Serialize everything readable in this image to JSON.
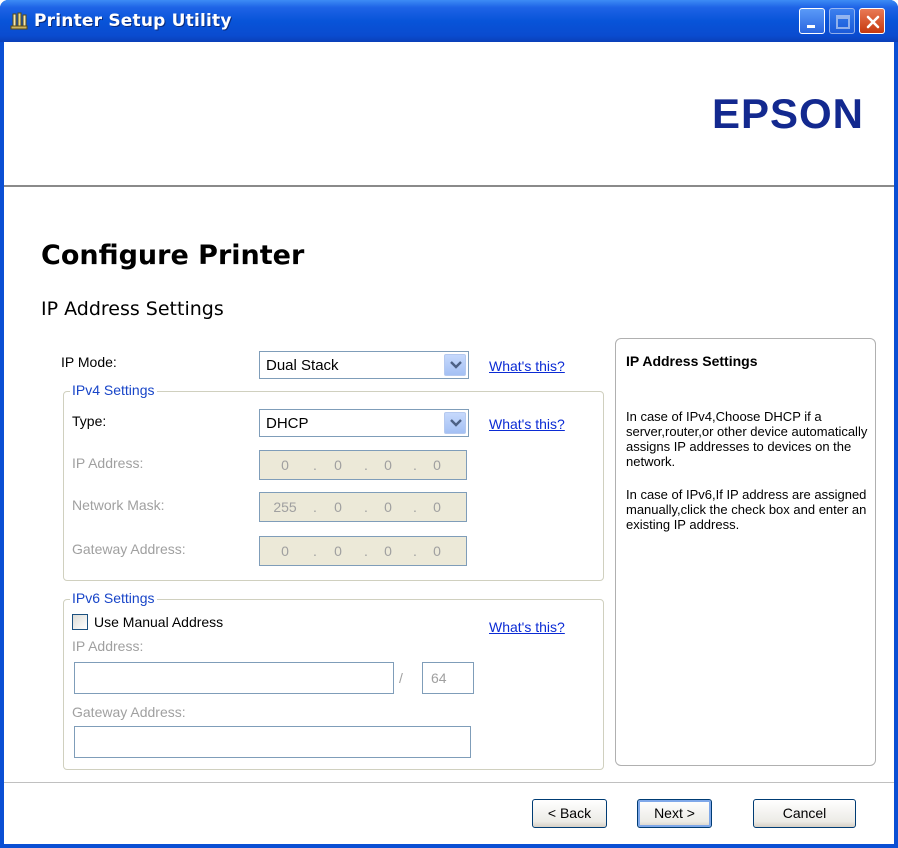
{
  "window": {
    "title": "Printer Setup Utility"
  },
  "header": {
    "logo": "EPSON"
  },
  "page": {
    "title": "Configure Printer",
    "subtitle": "IP Address Settings"
  },
  "ip_mode": {
    "label": "IP Mode:",
    "value": "Dual Stack",
    "help_link": "What's this?"
  },
  "ipv4": {
    "group_title": "IPv4 Settings",
    "type_label": "Type:",
    "type_value": "DHCP",
    "help_link": "What's this?",
    "ip_address_label": "IP Address:",
    "ip_address": [
      "0",
      "0",
      "0",
      "0"
    ],
    "network_mask_label": "Network Mask:",
    "network_mask": [
      "255",
      "0",
      "0",
      "0"
    ],
    "gateway_label": "Gateway Address:",
    "gateway": [
      "0",
      "0",
      "0",
      "0"
    ],
    "separator": "."
  },
  "ipv6": {
    "group_title": "IPv6 Settings",
    "manual_label": "Use Manual Address",
    "manual_checked": false,
    "help_link": "What's this?",
    "ip_address_label": "IP Address:",
    "ip_address_value": "",
    "slash": "/",
    "prefix_value": "64",
    "gateway_label": "Gateway Address:",
    "gateway_value": ""
  },
  "help_panel": {
    "title": "IP Address Settings",
    "paragraph1": "In case of IPv4,Choose DHCP if a server,router,or other device automatically assigns IP addresses to devices on the network.",
    "paragraph2": "In case of IPv6,If IP address are assigned manually,click the check box and enter an existing IP address."
  },
  "footer": {
    "back_label": "< Back",
    "next_label": "Next >",
    "cancel_label": "Cancel"
  },
  "colors": {
    "titlebar": "#0854d9",
    "logo": "#13298f",
    "link": "#0b2bd4",
    "group_title": "#1845c8",
    "disabled_text": "#a0a0a0"
  },
  "icons": {
    "app": "printer-utility-icon",
    "minimize": "minimize-icon",
    "maximize": "maximize-icon",
    "close": "close-icon",
    "dropdown": "chevron-down-icon"
  }
}
